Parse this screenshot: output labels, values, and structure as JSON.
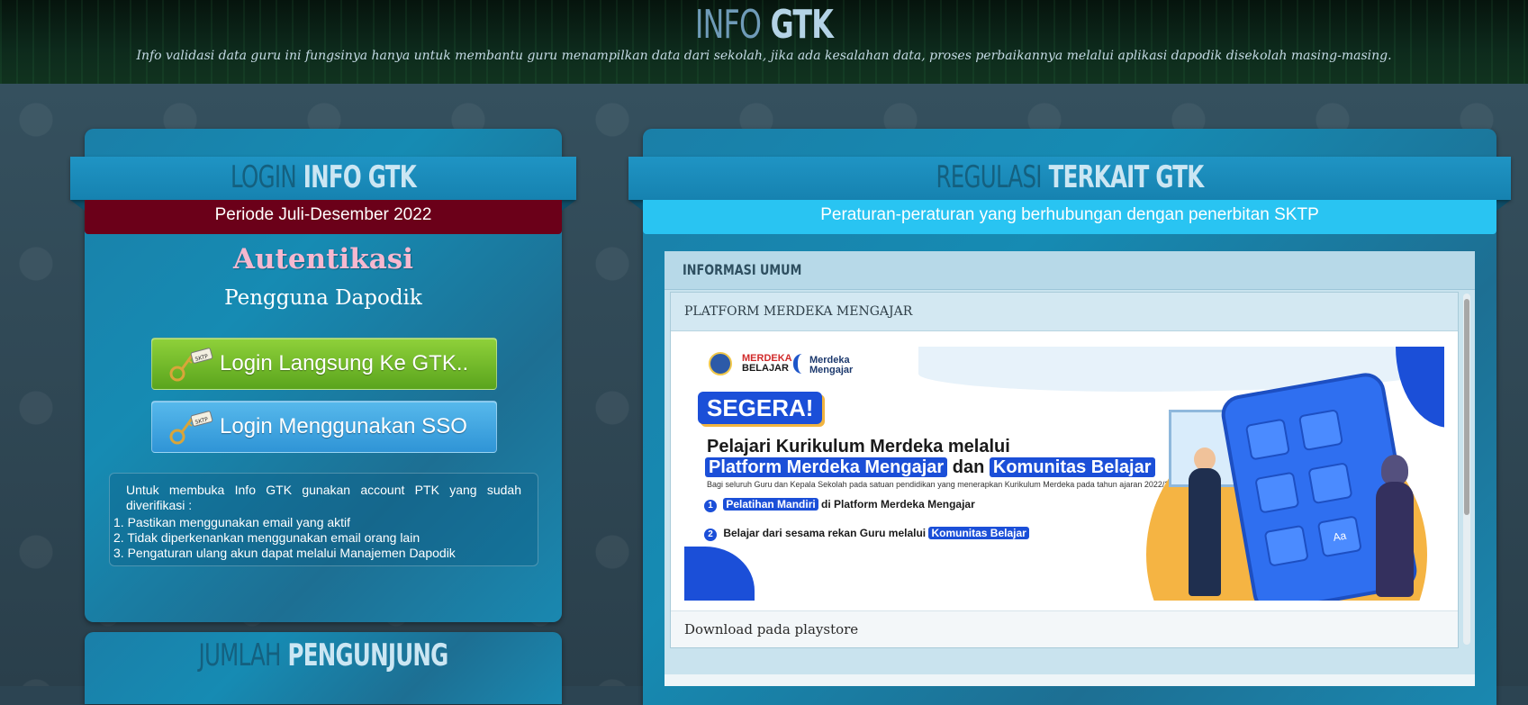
{
  "header": {
    "title_part1": "INFO",
    "title_part2": "GTK",
    "tagline": "Info validasi data guru ini fungsinya hanya untuk membantu guru menampilkan data dari sekolah, jika ada kesalahan data, proses perbaikannya melalui aplikasi dapodik disekolah masing-masing."
  },
  "login_panel": {
    "title_part1": "LOGIN",
    "title_part2": "INFO GTK",
    "period": "Periode Juli-Desember 2022",
    "auth_title": "Autentikasi",
    "auth_subtitle": "Pengguna Dapodik",
    "button_direct": "Login Langsung Ke GTK..",
    "button_sso": "Login Menggunakan SSO",
    "key_tag": "SKTP",
    "info_intro": "Untuk membuka Info GTK gunakan account PTK yang sudah diverifikasi :",
    "info_items": [
      "1. Pastikan menggunakan email yang aktif",
      "2. Tidak diperkenankan menggunakan email orang lain",
      "3. Pengaturan ulang akun dapat melalui Manajemen Dapodik"
    ],
    "colors": {
      "period_bar": "#6b0019",
      "green_button": "#6cb82a",
      "blue_button": "#3ea6e2"
    }
  },
  "visitor_panel": {
    "title_part1": "JUMLAH",
    "title_part2": "PENGUNJUNG"
  },
  "regulation_panel": {
    "title_part1": "REGULASI",
    "title_part2": "TERKAIT GTK",
    "subtitle": "Peraturan-peraturan yang berhubungan dengan penerbitan SKTP",
    "section_title": "INFORMASI UMUM",
    "card_title": "PLATFORM MERDEKA MENGAJAR",
    "card_footer": "Download pada playstore",
    "colors": {
      "subtitle_bar": "#29c4f2"
    }
  },
  "banner": {
    "logo_mb_line1": "MERDEKA",
    "logo_mb_line2": "BELAJAR",
    "logo_mm_line1": "Merdeka",
    "logo_mm_line2": "Mengajar",
    "segera": "SEGERA!",
    "line1": "Pelajari Kurikulum Merdeka melalui",
    "line2_hl1": "Platform Merdeka Mengajar",
    "line2_mid": "dan",
    "line2_hl2": "Komunitas Belajar",
    "small": "Bagi seluruh Guru dan Kepala Sekolah pada satuan pendidikan yang menerapkan Kurikulum Merdeka pada tahun ajaran 2022/2023",
    "item1_num": "1",
    "item1_hl": "Pelatihan Mandiri",
    "item1_rest": "di Platform Merdeka Mengajar",
    "item2_num": "2",
    "item2_text": "Belajar dari sesama rekan Guru melalui",
    "item2_hl": "Komunitas Belajar",
    "tile_text": "Aa"
  }
}
